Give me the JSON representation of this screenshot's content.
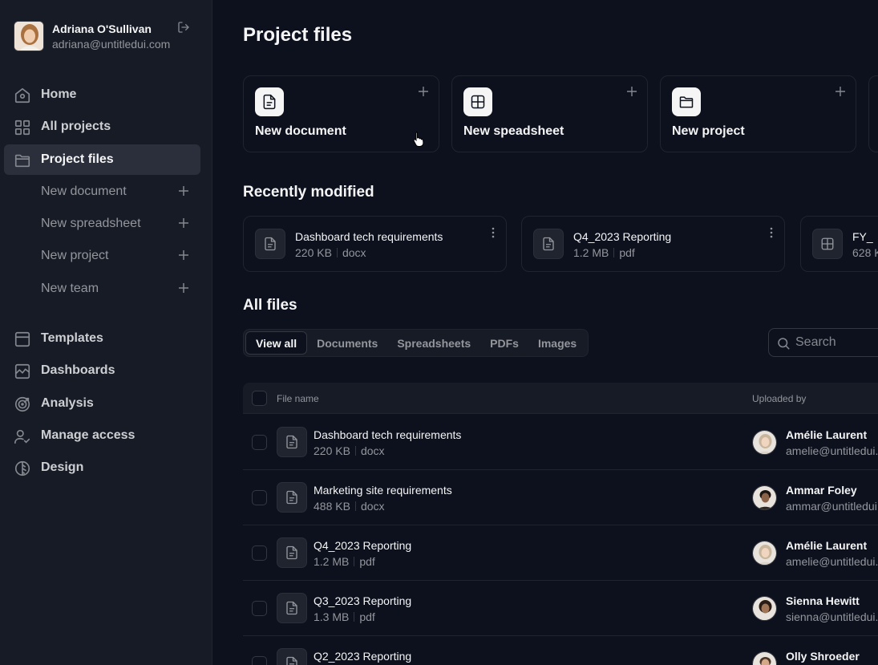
{
  "user": {
    "name": "Adriana O'Sullivan",
    "email": "adriana@untitledui.com"
  },
  "nav_top": [
    {
      "label": "Home",
      "icon": "home-icon"
    },
    {
      "label": "All projects",
      "icon": "grid-icon"
    },
    {
      "label": "Project files",
      "icon": "folder-icon",
      "active": true
    }
  ],
  "sub_items": [
    "New document",
    "New spreadsheet",
    "New project",
    "New team"
  ],
  "nav_bottom": [
    {
      "label": "Templates",
      "icon": "template-icon"
    },
    {
      "label": "Dashboards",
      "icon": "chart-icon"
    },
    {
      "label": "Analysis",
      "icon": "target-icon"
    },
    {
      "label": "Manage access",
      "icon": "users-icon"
    },
    {
      "label": "Design",
      "icon": "design-icon"
    }
  ],
  "page_title": "Project files",
  "quick_actions": [
    {
      "label": "New document",
      "icon": "document-icon"
    },
    {
      "label": "New speadsheet",
      "icon": "spreadsheet-icon"
    },
    {
      "label": "New project",
      "icon": "folder-icon"
    }
  ],
  "recent_title": "Recently modified",
  "recent": [
    {
      "name": "Dashboard tech requirements",
      "size": "220 KB",
      "type": "docx",
      "icon": "document-icon"
    },
    {
      "name": "Q4_2023 Reporting",
      "size": "1.2 MB",
      "type": "pdf",
      "icon": "document-icon"
    },
    {
      "name": "FY_",
      "size": "628 K",
      "type": "",
      "icon": "spreadsheet-icon"
    }
  ],
  "all_files_title": "All files",
  "tabs": [
    "View all",
    "Documents",
    "Spreadsheets",
    "PDFs",
    "Images"
  ],
  "active_tab": "View all",
  "search": {
    "placeholder": "Search"
  },
  "table": {
    "headers": {
      "file_name": "File name",
      "uploaded_by": "Uploaded by"
    },
    "rows": [
      {
        "name": "Dashboard tech requirements",
        "size": "220 KB",
        "type": "docx",
        "user": "Amélie Laurent",
        "email": "amelie@untitledui.",
        "avatar_color": "#c9b59b"
      },
      {
        "name": "Marketing site requirements",
        "size": "488 KB",
        "type": "docx",
        "user": "Ammar Foley",
        "email": "ammar@untitledui.",
        "avatar_color": "#6b4a34"
      },
      {
        "name": "Q4_2023 Reporting",
        "size": "1.2 MB",
        "type": "pdf",
        "user": "Amélie Laurent",
        "email": "amelie@untitledui.",
        "avatar_color": "#c9b59b"
      },
      {
        "name": "Q3_2023 Reporting",
        "size": "1.3 MB",
        "type": "pdf",
        "user": "Sienna Hewitt",
        "email": "sienna@untitledui.",
        "avatar_color": "#8a5f44"
      },
      {
        "name": "Q2_2023 Reporting",
        "size": "",
        "type": "",
        "user": "Olly Shroeder",
        "email": "",
        "avatar_color": "#a07e62"
      }
    ]
  },
  "colors": {
    "background": "#0c111d",
    "sidebar": "#161b26",
    "active_nav": "#2a2f3b",
    "text_primary": "#f5f5f6",
    "text_secondary": "#94969c"
  }
}
